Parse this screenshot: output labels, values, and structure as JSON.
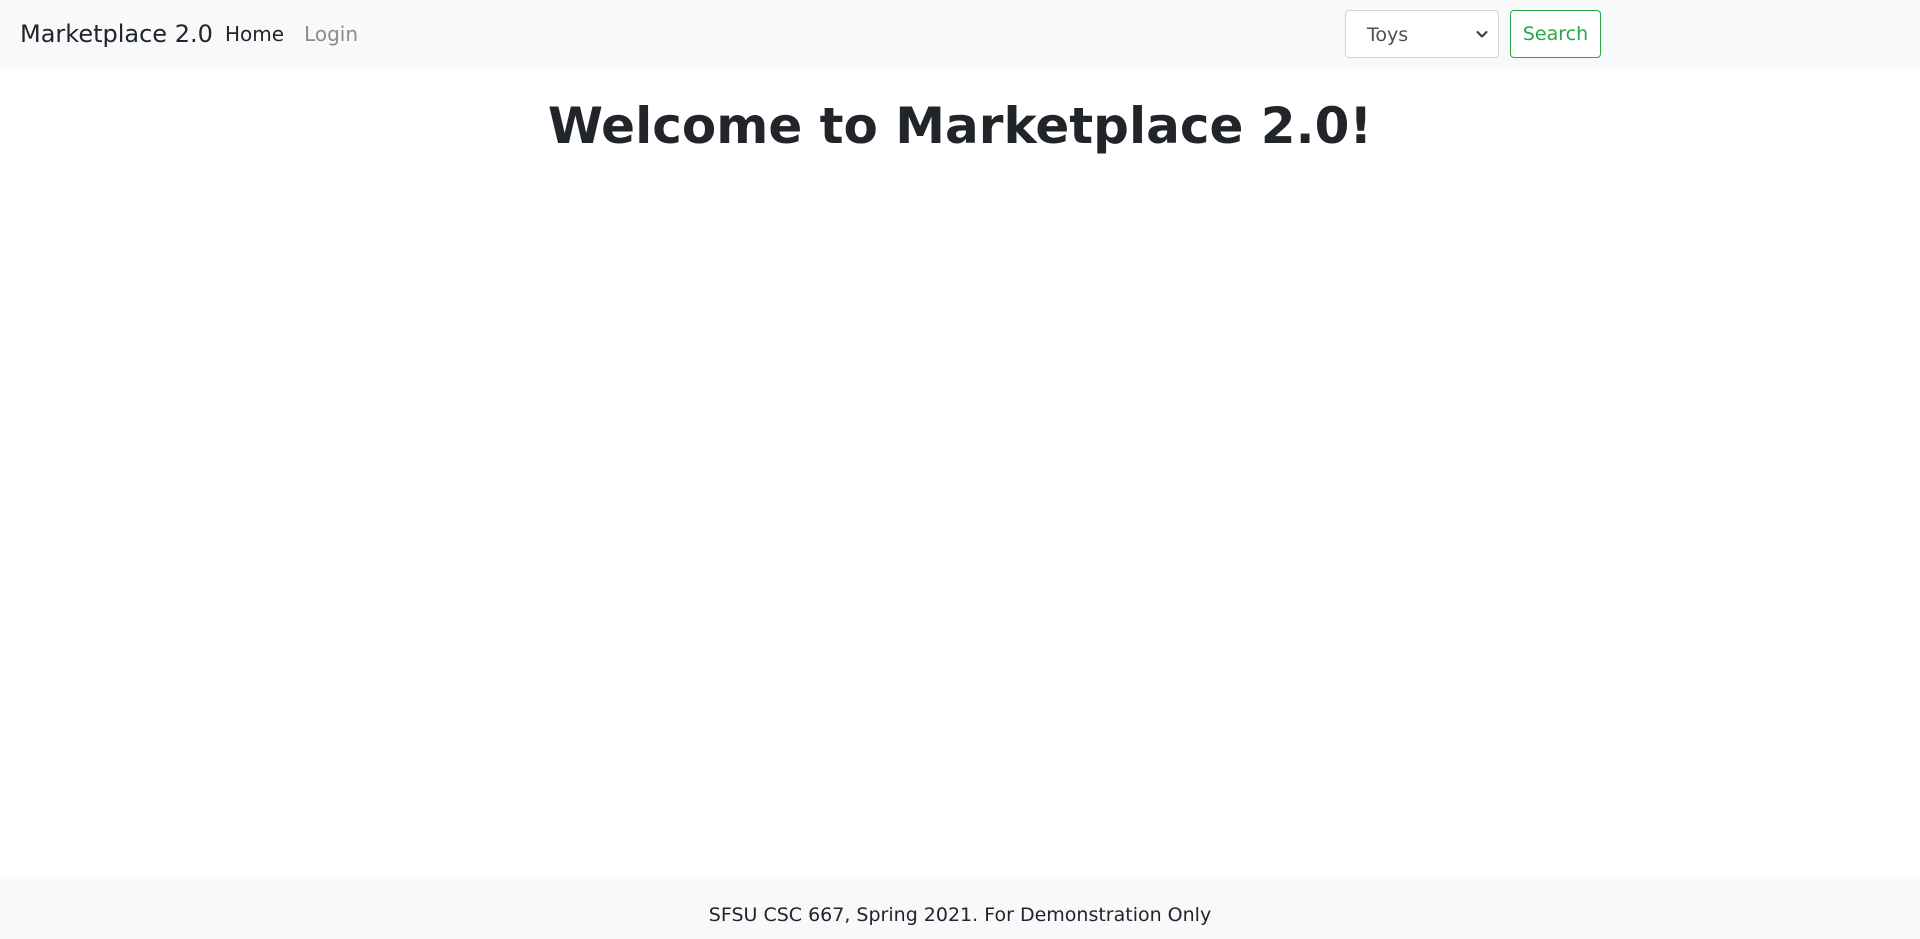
{
  "navbar": {
    "brand": "Marketplace 2.0",
    "links": [
      {
        "label": "Home"
      },
      {
        "label": "Login"
      }
    ],
    "search": {
      "category_selected": "Toys",
      "button_label": "Search"
    }
  },
  "main": {
    "title": "Welcome to Marketplace 2.0!"
  },
  "footer": {
    "text": "SFSU CSC 667, Spring 2021. For Demonstration Only"
  },
  "colors": {
    "navbar_bg": "#f8f9fa",
    "footer_bg": "#f8f9fa",
    "success": "#28a745",
    "muted_link": "#8c8c8c",
    "text": "#212529"
  },
  "icons": {
    "select_chevron": "chevron-down-icon"
  }
}
